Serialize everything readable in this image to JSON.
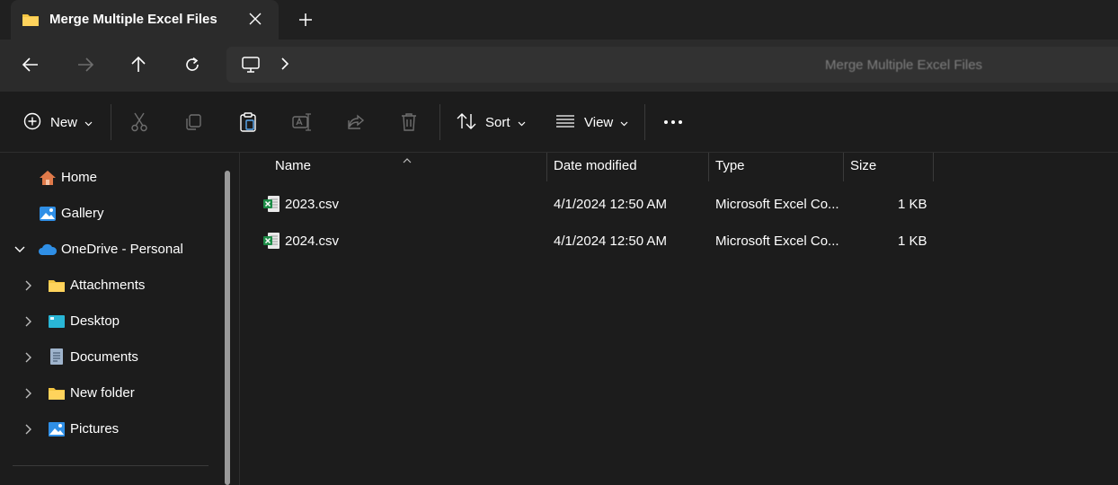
{
  "window": {
    "tab_title": "Merge Multiple Excel Files",
    "breadcrumb_current": "Merge Multiple Excel Files"
  },
  "toolbar": {
    "new_label": "New",
    "sort_label": "Sort",
    "view_label": "View"
  },
  "sidebar": {
    "items": [
      {
        "label": "Home",
        "icon": "home-icon"
      },
      {
        "label": "Gallery",
        "icon": "gallery-icon"
      },
      {
        "label": "OneDrive - Personal",
        "icon": "onedrive-cloud-icon",
        "expanded": true
      },
      {
        "label": "Attachments",
        "icon": "folder-icon"
      },
      {
        "label": "Desktop",
        "icon": "desktop-icon"
      },
      {
        "label": "Documents",
        "icon": "documents-icon"
      },
      {
        "label": "New folder",
        "icon": "folder-icon"
      },
      {
        "label": "Pictures",
        "icon": "pictures-icon"
      }
    ]
  },
  "columns": {
    "name": "Name",
    "date": "Date modified",
    "type": "Type",
    "size": "Size"
  },
  "files": [
    {
      "name": "2023.csv",
      "date": "4/1/2024 12:50 AM",
      "type": "Microsoft Excel Co...",
      "size": "1 KB"
    },
    {
      "name": "2024.csv",
      "date": "4/1/2024 12:50 AM",
      "type": "Microsoft Excel Co...",
      "size": "1 KB"
    }
  ],
  "colors": {
    "background": "#1c1c1c",
    "folder": "#f4c542",
    "excel_green": "#1d8c47",
    "onedrive_blue": "#2f8fe6"
  }
}
